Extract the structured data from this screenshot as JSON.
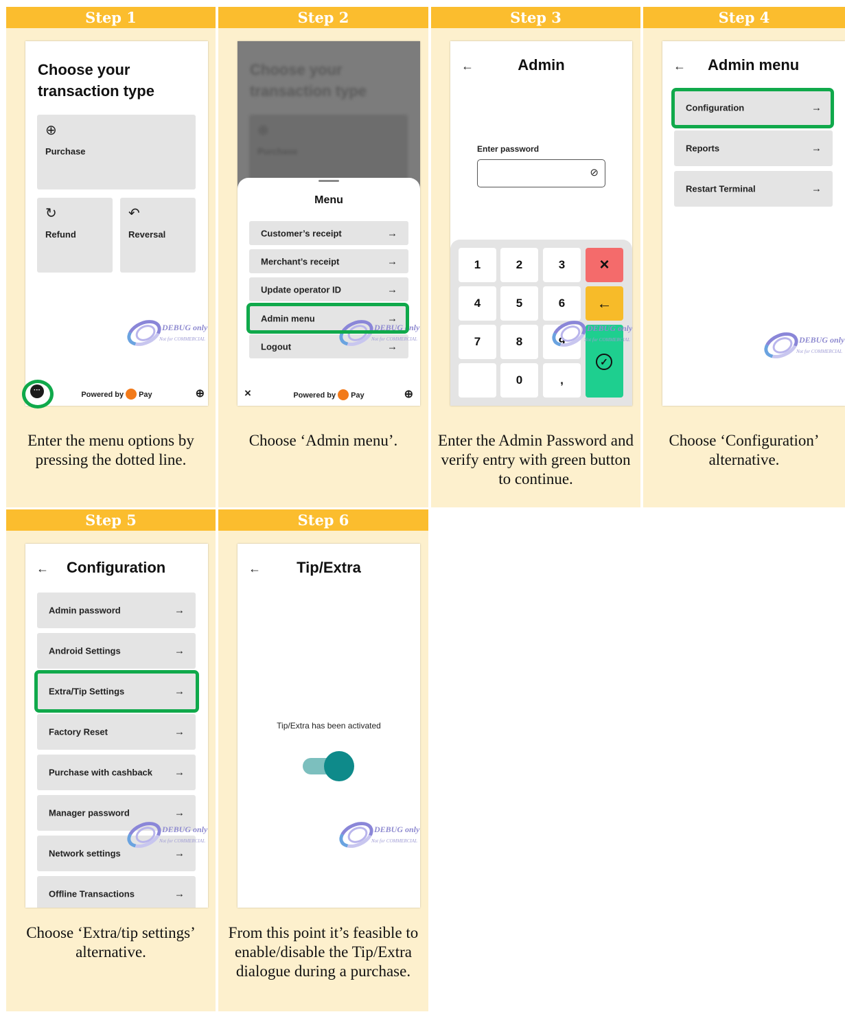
{
  "steps": [
    {
      "label": "Step 1",
      "caption": "Enter the menu options by pressing the dotted line.",
      "screen": {
        "title_line1": "Choose your",
        "title_line2": "transaction type",
        "tiles": [
          {
            "icon": "plus-circle-icon",
            "label": "Purchase"
          },
          {
            "icon": "refresh-icon",
            "label": "Refund"
          },
          {
            "icon": "reversal-icon",
            "label": "Reversal"
          }
        ],
        "menu_dots": "···",
        "powered_by": "Powered by",
        "pay": "Pay"
      }
    },
    {
      "label": "Step 2",
      "caption": "Choose ‘Admin menu’.",
      "screen": {
        "title_line1": "Choose your",
        "title_line2": "transaction type",
        "tile": "Purchase",
        "menu_title": "Menu",
        "menu_items": [
          "Customer’s receipt",
          "Merchant’s receipt",
          "Update operator ID",
          "Admin menu",
          "Logout"
        ],
        "close": "×",
        "powered_by": "Powered by",
        "pay": "Pay"
      }
    },
    {
      "label": "Step 3",
      "caption": "Enter the Admin Password and verify entry with green button to continue.",
      "screen": {
        "title": "Admin",
        "field_label": "Enter password",
        "keys": [
          "1",
          "2",
          "3",
          "4",
          "5",
          "6",
          "7",
          "8",
          "9",
          "",
          "0",
          ","
        ],
        "cancel": "×",
        "backspace": "←",
        "confirm": "✓"
      }
    },
    {
      "label": "Step 4",
      "caption": "Choose ‘Configuration’ alternative.",
      "screen": {
        "title": "Admin menu",
        "items": [
          "Configuration",
          "Reports",
          "Restart Terminal"
        ]
      }
    },
    {
      "label": "Step 5",
      "caption": "Choose ‘Extra/tip settings’ alternative.",
      "screen": {
        "title": "Configuration",
        "items": [
          "Admin password",
          "Android Settings",
          "Extra/Tip Settings",
          "Factory Reset",
          "Purchase with cashback",
          "Manager password",
          "Network settings",
          "Offline Transactions"
        ]
      }
    },
    {
      "label": "Step 6",
      "caption": "From this point it’s feasible to enable/disable the Tip/Extra dialogue during a purchase.",
      "screen": {
        "title": "Tip/Extra",
        "status": "Tip/Extra has been activated",
        "toggle_on": true
      }
    }
  ],
  "watermark": {
    "line1": "DEBUG only",
    "line2": "Not for COMMERCIAL"
  },
  "colors": {
    "header": "#fbbd2e",
    "panel": "#fdf0cd",
    "highlight": "#10a94b",
    "cancel_key": "#f46b6b",
    "back_key": "#f7bb29",
    "confirm_key": "#1ecf8f",
    "toggle": "#0e8a8a"
  }
}
